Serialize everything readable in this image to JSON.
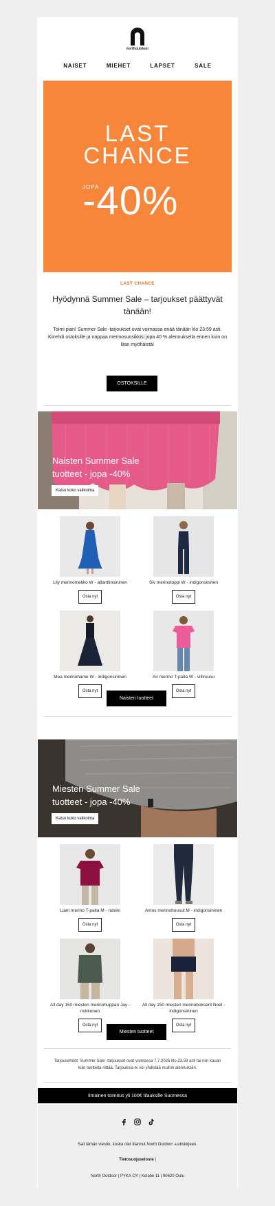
{
  "brand": {
    "logo_text": "northoutdoor"
  },
  "nav": [
    "NAISET",
    "MIEHET",
    "LAPSET",
    "SALE"
  ],
  "hero": {
    "line1": "LAST",
    "line2": "CHANCE",
    "upto": "JOPA",
    "percent": "-40%",
    "color": "#f7853a"
  },
  "intro": {
    "eyebrow": "LAST CHANCE",
    "headline": "Hyödynnä Summer Sale – tarjoukset päättyvät tänään!",
    "body": "Toimi pian! Summer Sale -tarjoukset ovat voimassa enää tänään klo 23:59 asti. Kiirehdi ostoksille ja nappaa merinosuosikkisi jopa 40 % alennuksella ennen kuin on liian myöhäistä!",
    "cta": "OSTOKSILLE"
  },
  "women": {
    "banner_title_1": "Naisten Summer Sale",
    "banner_title_2": "tuotteet - jopa -40%",
    "banner_button": "Katso koko valikoima",
    "products": [
      {
        "name": "Lily merinomekko W - atlanttinsininen",
        "buy": "Osta nyt"
      },
      {
        "name": "Siv merinotoppi W - indigonsininen",
        "buy": "Osta nyt"
      },
      {
        "name": "Mea merinohame W - indigonsininen",
        "buy": "Osta nyt"
      },
      {
        "name": "Air merino T-paita W - villiruusu",
        "buy": "Osta nyt"
      }
    ],
    "cta": "Naisten tuotteet"
  },
  "men": {
    "banner_title_1": "Miesten Summer Sale",
    "banner_title_2": "tuotteet - jopa -40%",
    "banner_button": "Katso koko valikoima",
    "products": [
      {
        "name": "Liam merino T-paita M - rubiini",
        "buy": "Osta nyt"
      },
      {
        "name": "Amos merinohousut M - indigonsininen",
        "buy": "Osta nyt"
      },
      {
        "name_1": "All day 150 miesten merinohuppari Jay -",
        "name_2": "nokkonen",
        "buy": "Osta nyt"
      },
      {
        "name_1": "All day 150 miesten merinobokserit Noel -",
        "name_2": "indigonsininen",
        "buy": "Osta nyt"
      }
    ],
    "cta": "Miesten tuotteet"
  },
  "terms": {
    "line1": "Tarjousehdot: Summer Sale -tarjoukset ovat voimassa 7.7.2025 klo 23.59 asti tai niin kauan",
    "line2": "kuin tuotteita riittää.  Tarjouksia ei voi yhdistää muihin alennuksiin."
  },
  "shipping": "Ilmainen toimitus yli 100€ tilauksille Suomessa",
  "footer": {
    "social": [
      "facebook-icon",
      "instagram-icon",
      "tiktok-icon"
    ],
    "reason": "Sait tämän viestin, koska olet tilannut North Outdoor -uutiskirjeen.",
    "privacy": "Tietosuojaseloste",
    "privacy_sep": " |",
    "address": "North Outdoor | PYKA OY | Kelatie 11 | 90620 Oulu"
  }
}
